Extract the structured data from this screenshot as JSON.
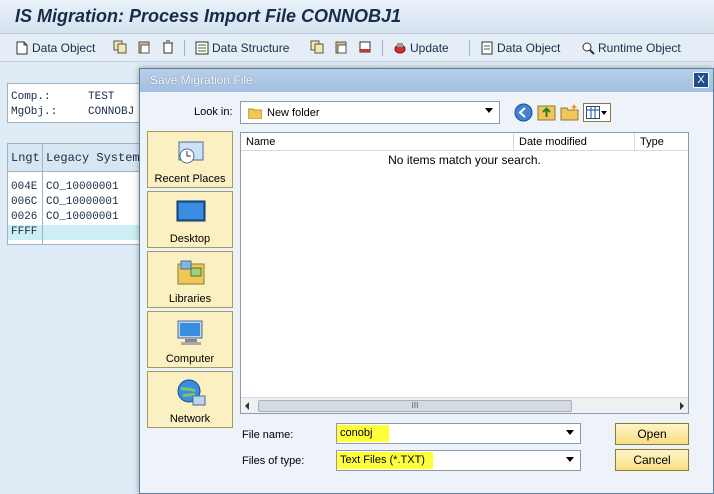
{
  "window": {
    "title": "IS Migration: Process Import File CONNOBJ1"
  },
  "toolbar": {
    "items": [
      {
        "label": "Data Object"
      },
      {
        "label": "Data Structure"
      },
      {
        "label": "Update"
      },
      {
        "label": "Data Object"
      },
      {
        "label": "Runtime Object"
      }
    ]
  },
  "info": {
    "comp_label": "Comp.:",
    "comp_value": "TEST",
    "mgobj_label": "MgObj.:",
    "mgobj_value": "CONNOBJ"
  },
  "grid": {
    "headers": [
      "Lngt",
      "Legacy System"
    ],
    "rows": [
      [
        "004E",
        "CO_10000001"
      ],
      [
        "006C",
        "CO_10000001"
      ],
      [
        "0026",
        "CO_10000001"
      ],
      [
        "FFFF",
        ""
      ]
    ]
  },
  "dialog": {
    "title": "Save Migration File",
    "look_in_label": "Look in:",
    "look_in_value": "New folder",
    "places": [
      "Recent Places",
      "Desktop",
      "Libraries",
      "Computer",
      "Network"
    ],
    "columns": [
      "Name",
      "Date modified",
      "Type"
    ],
    "empty_message": "No items match your search.",
    "scroll_grip": "III",
    "file_name_label": "File name:",
    "file_name_value": "conobj",
    "file_type_label": "Files of type:",
    "file_type_value": "Text Files (*.TXT)",
    "open_button": "Open",
    "cancel_button": "Cancel",
    "close_glyph": "X"
  }
}
